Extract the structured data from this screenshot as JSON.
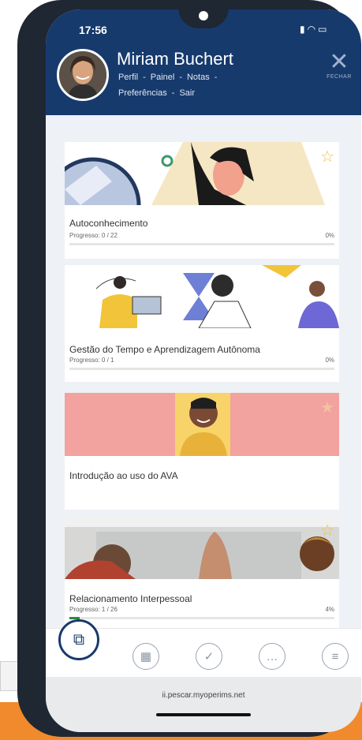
{
  "status_bar": {
    "time": "17:56",
    "icons": "signal wifi battery"
  },
  "header": {
    "user_name": "Miriam Buchert",
    "nav_line1": [
      "Perfil",
      "-",
      "Painel",
      "-",
      "Notas",
      "-"
    ],
    "nav_line2": [
      "Preferências",
      "-",
      "Sair"
    ],
    "close_label": "FECHAR"
  },
  "courses": [
    {
      "title": "Autoconhecimento",
      "progress_text": "Progresso: 0 / 22",
      "percent_text": "0%",
      "progress": 0
    },
    {
      "title": "Gestão do Tempo e Aprendizagem Autônoma",
      "progress_text": "Progresso: 0 / 1",
      "percent_text": "0%",
      "progress": 0
    },
    {
      "title": "Introdução ao uso do AVA",
      "progress_text": "",
      "percent_text": "",
      "progress": 0
    },
    {
      "title": "Relacionamento Interpessoal",
      "progress_text": "Progresso: 1 / 26",
      "percent_text": "4%",
      "progress": 0.04
    }
  ],
  "bottom_nav": {
    "icons": [
      "sitemap-icon",
      "calendar-icon",
      "check-icon",
      "chat-icon",
      "message-icon"
    ]
  },
  "browser": {
    "url": "ii.pescar.myoperims.net"
  },
  "colors": {
    "header": "#173a6d",
    "progress": "#2e8b3a",
    "star": "#e6c34a",
    "background_orange": "#f08a2c"
  }
}
